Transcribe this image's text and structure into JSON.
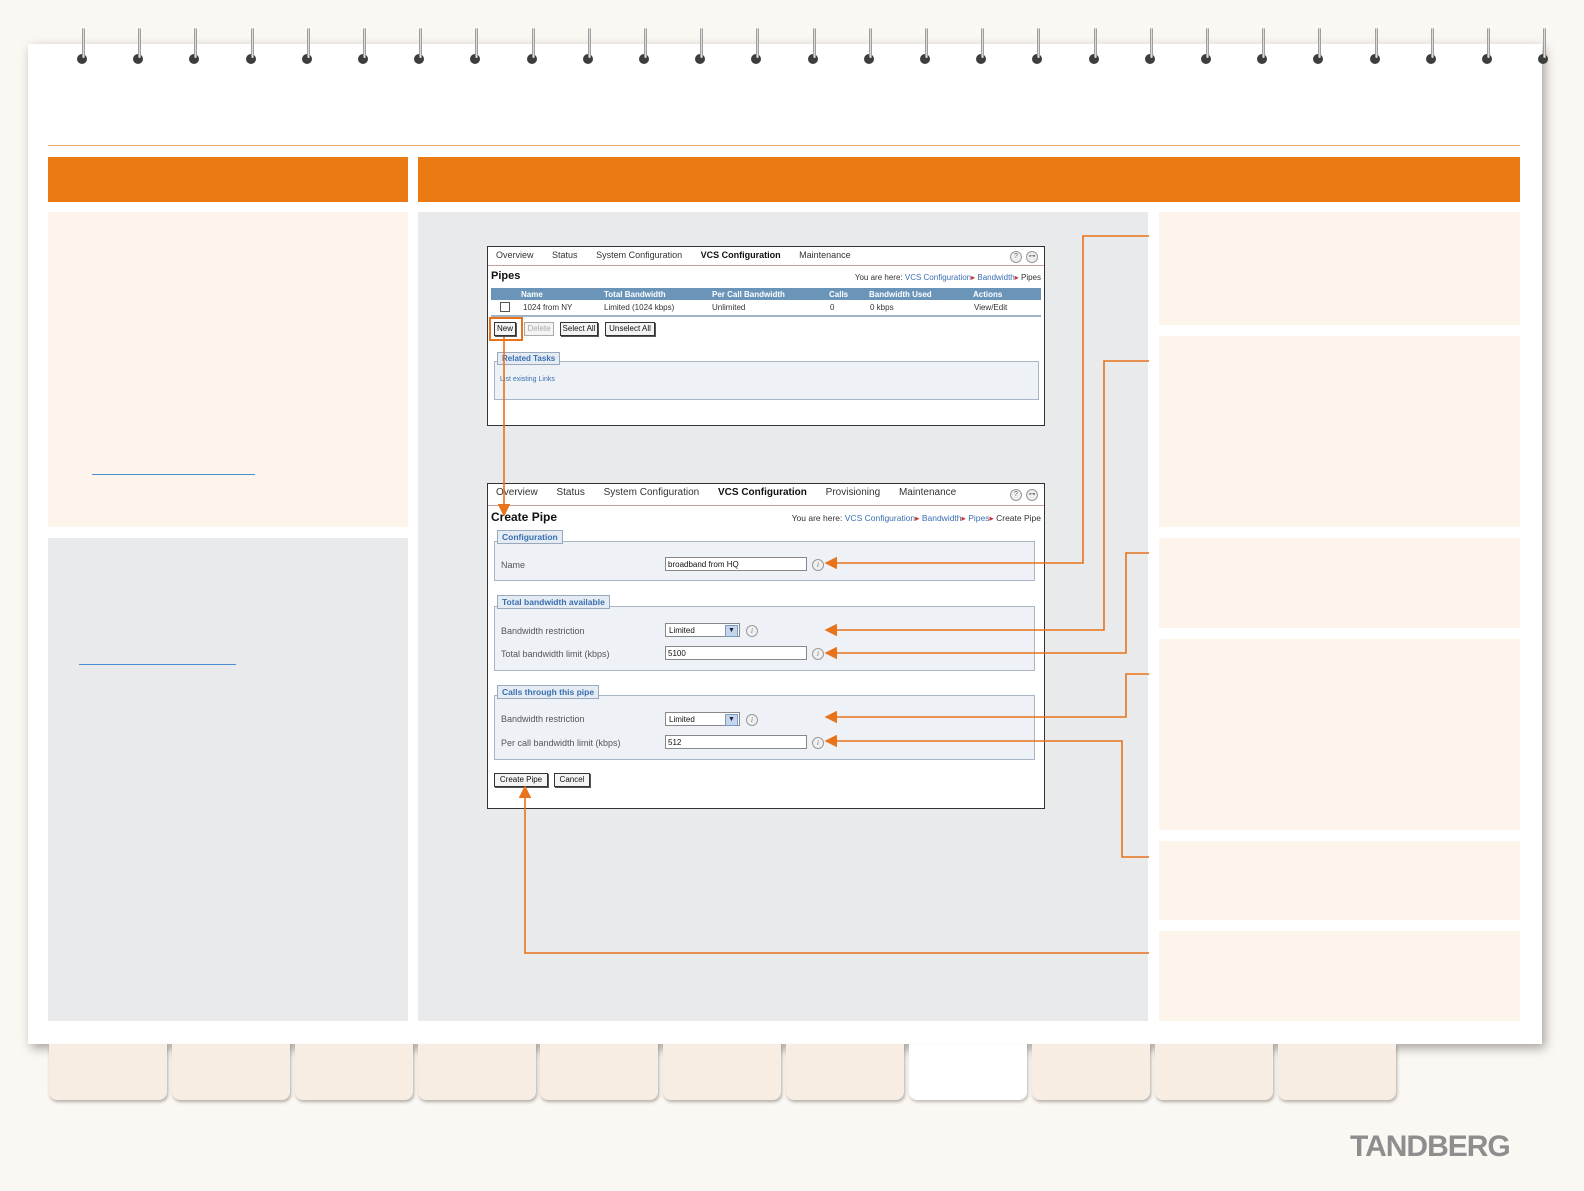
{
  "pipes_screen": {
    "nav": {
      "overview": "Overview",
      "status": "Status",
      "system_configuration": "System Configuration",
      "vcs_configuration": "VCS Configuration",
      "maintenance": "Maintenance"
    },
    "title": "Pipes",
    "breadcrumb": {
      "prefix": "You are here:",
      "vcs_configuration": "VCS Configuration",
      "bandwidth": "Bandwidth",
      "current": "Pipes"
    },
    "table": {
      "headers": [
        "Name",
        "Total Bandwidth",
        "Per Call Bandwidth",
        "Calls",
        "Bandwidth Used",
        "Actions"
      ],
      "rows": [
        {
          "name": "1024 from NY",
          "total": "Limited (1024 kbps)",
          "per_call": "Unlimited",
          "calls": "0",
          "used": "0 kbps",
          "action": "View/Edit"
        }
      ]
    },
    "buttons": {
      "new": "New",
      "delete": "Delete",
      "select_all": "Select All",
      "unselect_all": "Unselect All"
    },
    "related_tasks": {
      "legend": "Related Tasks",
      "link": "List existing Links"
    }
  },
  "create_pipe_screen": {
    "nav": {
      "overview": "Overview",
      "status": "Status",
      "system_configuration": "System Configuration",
      "vcs_configuration": "VCS Configuration",
      "provisioning": "Provisioning",
      "maintenance": "Maintenance"
    },
    "title": "Create Pipe",
    "breadcrumb": {
      "prefix": "You are here:",
      "vcs_configuration": "VCS Configuration",
      "bandwidth": "Bandwidth",
      "pipes": "Pipes",
      "current": "Create Pipe"
    },
    "configuration": {
      "legend": "Configuration",
      "name_label": "Name",
      "name_value": "broadband from HQ"
    },
    "total_bandwidth": {
      "legend": "Total bandwidth available",
      "restriction_label": "Bandwidth restriction",
      "restriction_value": "Limited",
      "limit_label": "Total bandwidth limit (kbps)",
      "limit_value": "5100"
    },
    "calls_through_pipe": {
      "legend": "Calls through this pipe",
      "restriction_label": "Bandwidth restriction",
      "restriction_value": "Limited",
      "limit_label": "Per call bandwidth limit (kbps)",
      "limit_value": "512"
    },
    "buttons": {
      "create": "Create Pipe",
      "cancel": "Cancel"
    }
  },
  "brand": {
    "logo_text": "TANDBERG"
  },
  "icons": {
    "help": "help-icon",
    "logout": "logout-icon",
    "info": "info-icon",
    "dropdown": "chevron-down-icon"
  },
  "colors": {
    "accent_orange": "#ea7b14",
    "callout_orange": "#e8731a",
    "table_header": "#6a94b8",
    "link_blue": "#3a6fb0"
  }
}
